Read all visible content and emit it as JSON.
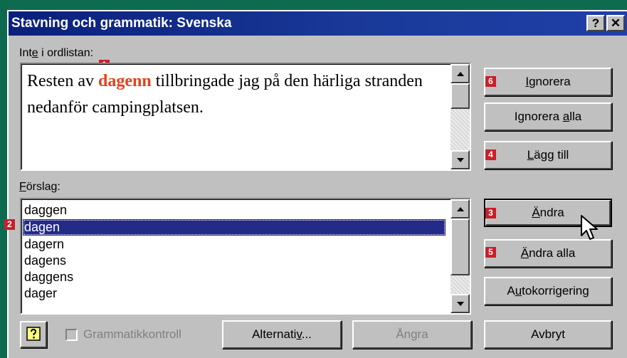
{
  "window": {
    "title": "Stavning och grammatik: Svenska",
    "help_button": "?",
    "close_button": "✕"
  },
  "not_in_dictionary": {
    "label_pre": "Int",
    "label_accel": "e",
    "label_post": " i ordlistan:",
    "text_before": "Resten av ",
    "error_word": "dagenn",
    "text_after": " tillbringade jag på den härliga stranden nedanför campingplatsen."
  },
  "suggestions": {
    "label_accel": "F",
    "label_post": "örslag:",
    "items": [
      "daggen",
      "dagen",
      "dagern",
      "dagens",
      "daggens",
      "dager"
    ],
    "selected": "dagen"
  },
  "buttons": {
    "ignore": {
      "pre": "",
      "accel": "I",
      "post": "gnorera"
    },
    "ignore_all": {
      "pre": "Ignorera ",
      "accel": "a",
      "post": "lla"
    },
    "add": {
      "pre": "",
      "accel": "L",
      "post": "ägg till"
    },
    "change": {
      "pre": "",
      "accel": "Ä",
      "post": "ndra"
    },
    "change_all": {
      "pre": "",
      "accel": "Ä",
      "post": "ndra alla"
    },
    "autocorrect": {
      "pre": "A",
      "accel": "u",
      "post": "tokorrigering"
    },
    "options": {
      "pre": "Alternati",
      "accel": "v",
      "post": "..."
    },
    "undo": {
      "label": "Ångra"
    },
    "cancel": {
      "label": "Avbryt"
    }
  },
  "grammar_check": {
    "label": "Grammatikkontroll",
    "checked": false,
    "enabled": false
  },
  "badges": {
    "b1": "1",
    "b2": "2",
    "b3": "3",
    "b4": "4",
    "b5": "5",
    "b6": "6"
  },
  "icons": {
    "help": "help-question-icon",
    "scroll_up": "arrow-up-icon",
    "scroll_down": "arrow-down-icon",
    "cursor": "mouse-pointer-icon"
  }
}
